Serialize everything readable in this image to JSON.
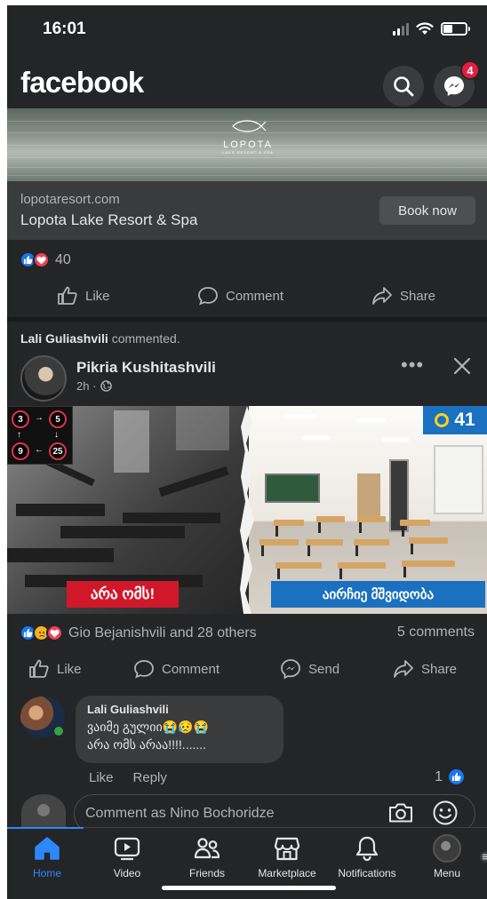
{
  "status_bar": {
    "time": "16:01"
  },
  "header": {
    "logo": "facebook",
    "messenger_badge": "4"
  },
  "ad": {
    "brand": "LOPOTA",
    "brand_sub": "LAKE RESORT & SPA",
    "domain": "lopotaresort.com",
    "name": "Lopota Lake Resort & Spa",
    "cta": "Book now",
    "reaction_count": "40"
  },
  "actions_1": {
    "like": "Like",
    "comment": "Comment",
    "share": "Share"
  },
  "post": {
    "activity_name": "Lali Guliashvili",
    "activity_text": " commented.",
    "author": "Pikria Kushitashvili",
    "time": "2h ·",
    "image": {
      "score": "41",
      "left_banner": "არა ომს!",
      "right_banner": "აირჩიე მშვიდობა",
      "grid_numbers": [
        "3",
        "5",
        "9",
        "25"
      ]
    },
    "reactions_text": "Gio Bejanishvili and 28 others",
    "comments_count": "5 comments"
  },
  "actions_2": {
    "like": "Like",
    "comment": "Comment",
    "send": "Send",
    "share": "Share"
  },
  "comment": {
    "name": "Lali Guliashvili",
    "text": "ვაიმე გულიი😭😥😭\nარა ომს არაა!!!!.......",
    "like": "Like",
    "reply": "Reply",
    "likes": "1"
  },
  "composer": {
    "placeholder": "Comment as Nino Bochoridze"
  },
  "nav": {
    "home": "Home",
    "video": "Video",
    "friends": "Friends",
    "marketplace": "Marketplace",
    "notifications": "Notifications",
    "menu": "Menu"
  },
  "colors": {
    "accent": "#2d88ff",
    "like": "#1877f2",
    "love": "#f33e58",
    "background": "#242526"
  }
}
